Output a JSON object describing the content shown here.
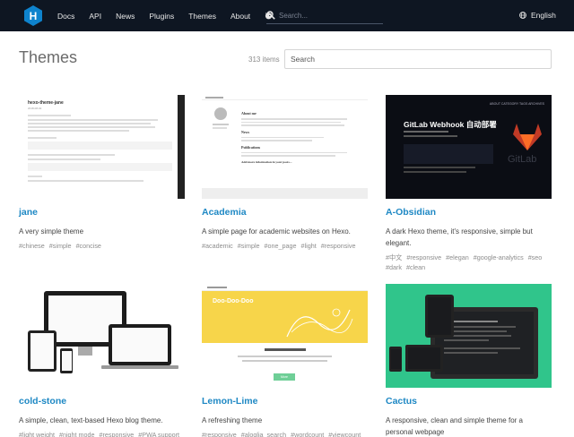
{
  "header": {
    "nav": [
      "Docs",
      "API",
      "News",
      "Plugins",
      "Themes",
      "About"
    ],
    "search_placeholder": "Search...",
    "language": "English"
  },
  "page": {
    "title": "Themes",
    "count": "313 items",
    "filter_placeholder": "Search"
  },
  "themes": [
    {
      "name": "jane",
      "description": "A very simple theme",
      "tags": [
        "#chinese",
        "#simple",
        "#concise"
      ],
      "preview": {
        "title": "hexo-theme-jane",
        "date": "2018-08-02"
      }
    },
    {
      "name": "Academia",
      "description": "A simple page for academic websites on Hexo.",
      "tags": [
        "#academic",
        "#simple",
        "#one_page",
        "#light",
        "#responsive"
      ],
      "preview": {
        "about": "About me",
        "news": "News",
        "publications": "Publications",
        "more": "Add more information in your posts..."
      }
    },
    {
      "name": "A-Obsidian",
      "description": "A dark Hexo theme, it's responsive, simple but elegant.",
      "tags": [
        "#中文",
        "#responsive",
        "#elegan",
        "#google-analytics",
        "#seo",
        "#dark",
        "#clean"
      ],
      "preview": {
        "headline": "GitLab Webhook 自动部署",
        "nav": "ABOUT CATEGORY TAGS ARCHIVES",
        "watermark": "GitLab"
      }
    },
    {
      "name": "cold-stone",
      "description": "A simple, clean, text-based Hexo blog theme.",
      "tags": [
        "#light weight",
        "#night mode",
        "#responsive",
        "#PWA support"
      ],
      "preview": {}
    },
    {
      "name": "Lemon-Lime",
      "description": "A refreshing theme",
      "tags": [
        "#responsive",
        "#aloglia_search",
        "#wordcount",
        "#viewcount"
      ],
      "preview": {
        "banner": "Doo-Doo-Doo",
        "button": "More"
      }
    },
    {
      "name": "Cactus",
      "description": "A responsive, clean and simple theme for a personal webpage",
      "tags": [],
      "preview": {}
    }
  ],
  "colors": {
    "header_bg": "#0e1622",
    "link": "#1e88c4",
    "hexo_logo": "#0e83cd",
    "cactus_bg": "#30c58b",
    "lemon_yellow": "#f7d54a",
    "obsidian_bg": "#0b0d14"
  }
}
